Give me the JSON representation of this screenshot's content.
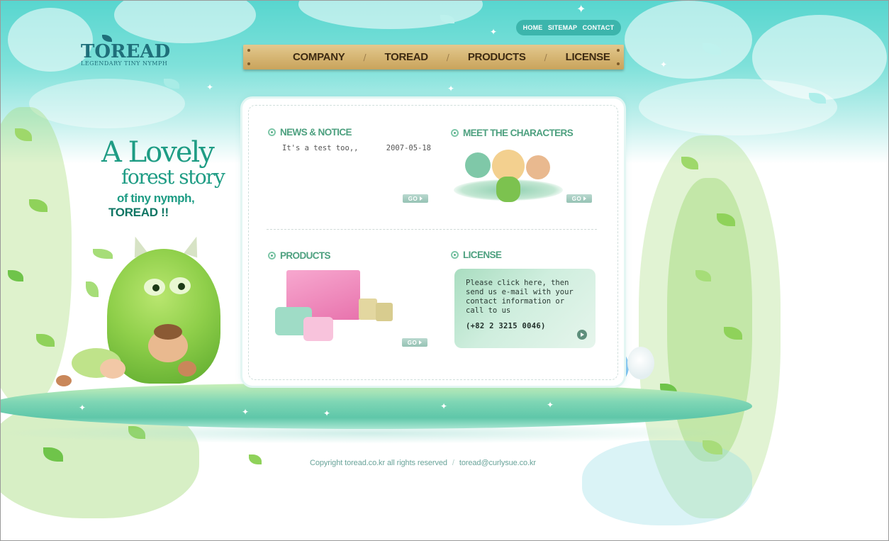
{
  "header": {
    "logo": {
      "brand": "TOREAD",
      "tagline": "LEGENDARY TINY NYMPH"
    },
    "util_nav": [
      "HOME",
      "SITEMAP",
      "CONTACT"
    ],
    "main_nav": [
      "COMPANY",
      "TOREAD",
      "PRODUCTS",
      "LICENSE"
    ],
    "nav_separator": "/"
  },
  "slogan": {
    "line1": "A Lovely",
    "line2": "forest story",
    "line3": "of tiny nymph,",
    "line4": "TOREAD !!"
  },
  "sections": {
    "news": {
      "title": "NEWS & NOTICE",
      "items": [
        {
          "title": "It's a test too,,",
          "date": "2007-05-18"
        }
      ],
      "go_label": "GO"
    },
    "characters": {
      "title": "MEET THE CHARACTERS",
      "go_label": "GO"
    },
    "products": {
      "title": "PRODUCTS",
      "go_label": "GO"
    },
    "license": {
      "title": "LICENSE",
      "message": "Please click here, then send us e-mail with your contact information or call to us",
      "phone": "(+82 2 3215 0046)"
    }
  },
  "footer": {
    "copyright": "Copyright toread.co.kr all rights reserved",
    "separator": "/",
    "email": "toread@curlysue.co.kr"
  },
  "colors": {
    "sky": "#58d6cf",
    "accent_green": "#4da07f",
    "wood": "#d6b674",
    "nav_pill": "#3cb5ac"
  }
}
